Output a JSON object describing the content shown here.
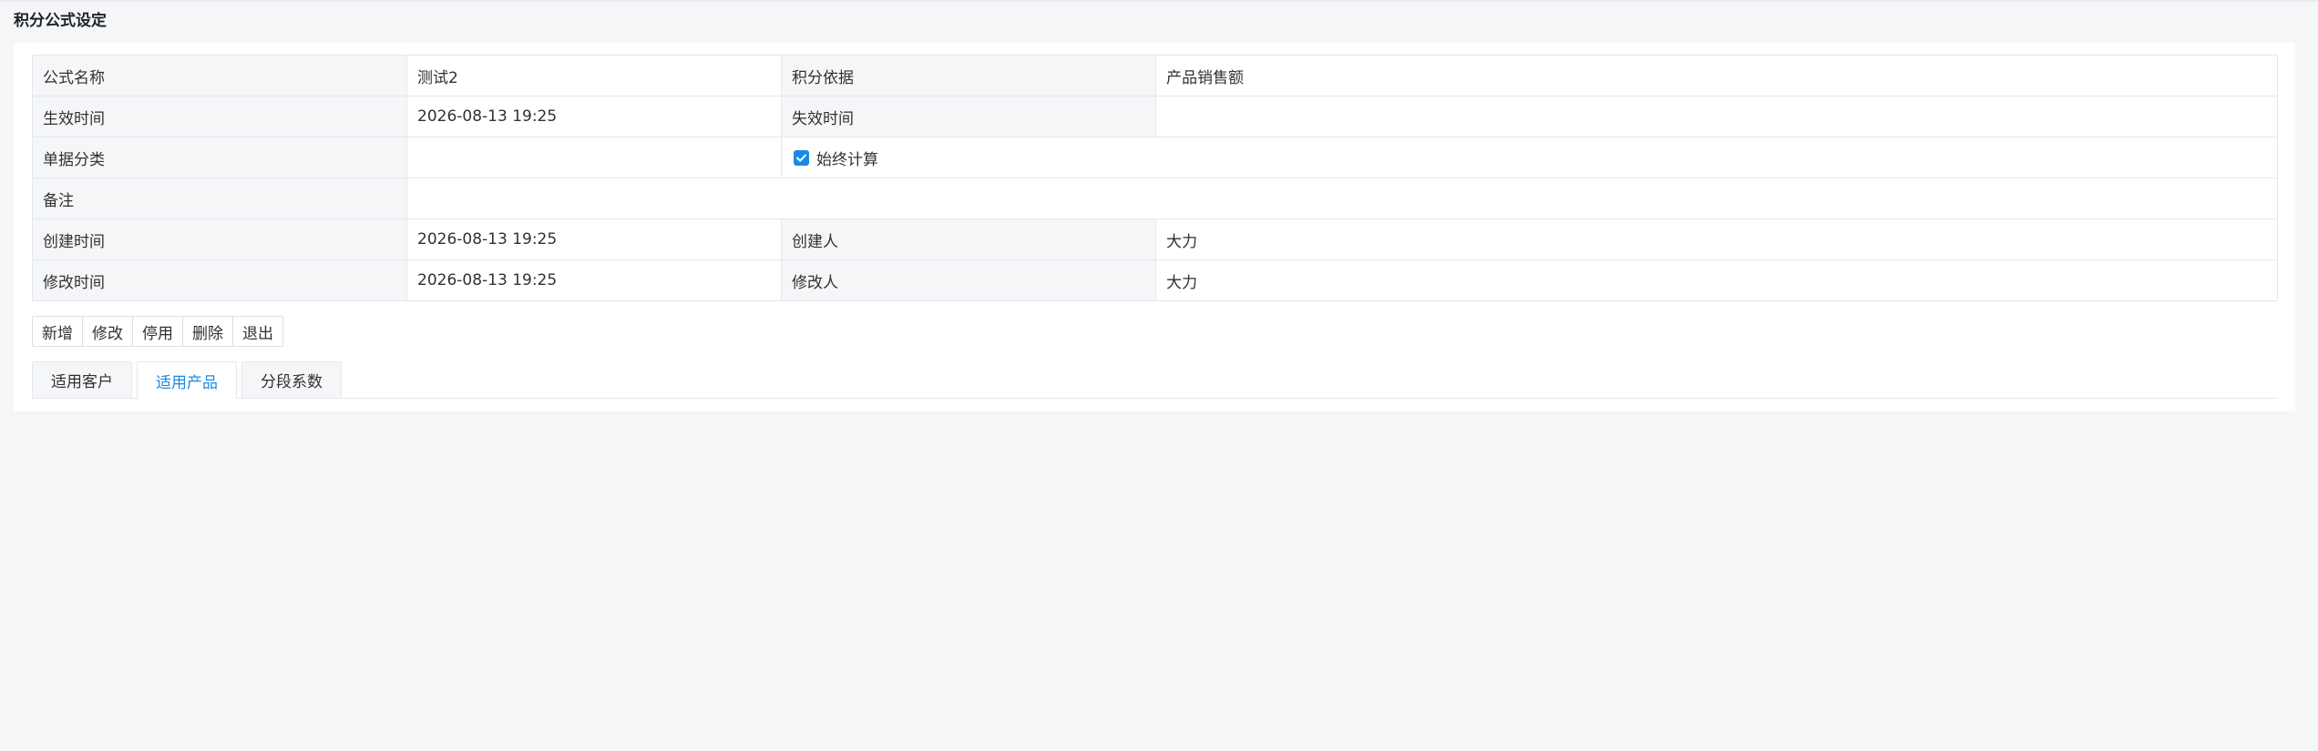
{
  "page": {
    "title": "积分公式设定"
  },
  "form": {
    "row1": {
      "label1": "公式名称",
      "value1": "测试2",
      "label2": "积分依据",
      "value2": "产品销售额"
    },
    "row2": {
      "label1": "生效时间",
      "value1": "2026-08-13 19:25",
      "label2": "失效时间",
      "value2": ""
    },
    "row3": {
      "label1": "单据分类",
      "value1": "",
      "checkbox_label": "始终计算",
      "checkbox_checked": true
    },
    "row4": {
      "label1": "备注",
      "value1": ""
    },
    "row5": {
      "label1": "创建时间",
      "value1": "2026-08-13 19:25",
      "label2": "创建人",
      "value2": "大力"
    },
    "row6": {
      "label1": "修改时间",
      "value1": "2026-08-13 19:25",
      "label2": "修改人",
      "value2": "大力"
    }
  },
  "toolbar": {
    "add_label": "新增",
    "edit_label": "修改",
    "disable_label": "停用",
    "delete_label": "删除",
    "exit_label": "退出"
  },
  "tabs": [
    {
      "label": "适用客户",
      "active": false
    },
    {
      "label": "适用产品",
      "active": true
    },
    {
      "label": "分段系数",
      "active": false
    }
  ],
  "colors": {
    "accent": "#1e88e5",
    "background": "#f5f6f8",
    "border": "#e4e7ed"
  }
}
